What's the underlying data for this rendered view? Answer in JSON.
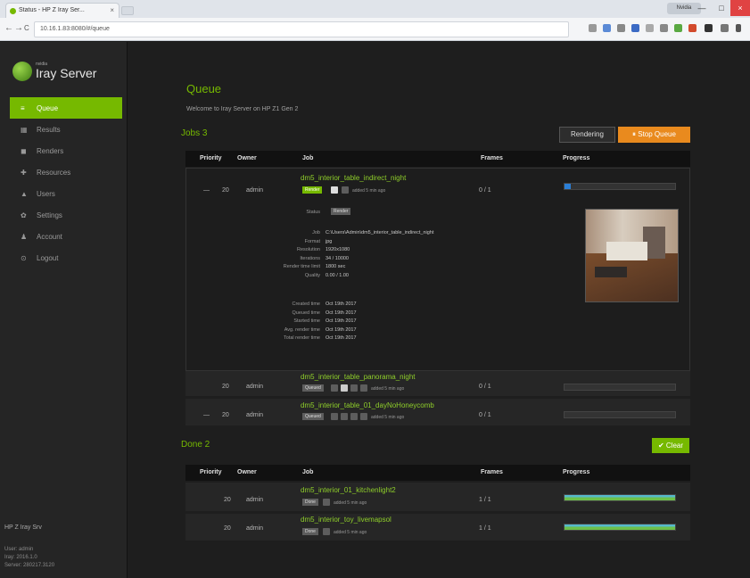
{
  "browser": {
    "tab_title": "Status - HP Z Iray Ser...",
    "tab_close": "×",
    "url": "10.16.1.83:8080/#/queue",
    "user": "Nvidia",
    "controls": {
      "minimize": "—",
      "maximize": "□",
      "close": "×"
    },
    "nav": {
      "back": "←",
      "forward": "→",
      "reload": "C"
    }
  },
  "sidebar": {
    "brand_small": "nvidia",
    "brand": "Iray Server",
    "items": [
      {
        "label": "Queue",
        "icon": "≡",
        "active": true
      },
      {
        "label": "Results",
        "icon": "▦"
      },
      {
        "label": "Renders",
        "icon": "◼"
      },
      {
        "label": "Resources",
        "icon": "✚"
      },
      {
        "label": "Users",
        "icon": "▲"
      },
      {
        "label": "Settings",
        "icon": "✿"
      },
      {
        "label": "Account",
        "icon": "♟"
      },
      {
        "label": "Logout",
        "icon": "⊙"
      }
    ],
    "footer": {
      "title": "HP Z Iray Srv",
      "line1": "User: admin",
      "line2": "Iray: 2016.1.0",
      "line3": "Server: 280217.3120"
    }
  },
  "main": {
    "title": "Queue",
    "welcome": "Welcome to Iray Server on HP Z1 Gen 2",
    "jobs_title": "Jobs 3",
    "rendering_label": "Rendering",
    "stop_label": "⏸ Stop Queue",
    "done_title": "Done 2",
    "clear_label": "✔ Clear",
    "columns": {
      "priority": "Priority",
      "owner": "Owner",
      "job": "Job",
      "frames": "Frames",
      "progress": "Progress"
    },
    "jobs": [
      {
        "dash": "—",
        "priority": "20",
        "owner": "admin",
        "name": "dm5_interior_table_indirect_night",
        "status": "Render",
        "extra": "added 5 min ago",
        "frames": "0 / 1",
        "progress": 0.06,
        "progress_color": "#2b7fd6"
      },
      {
        "dash": "",
        "priority": "20",
        "owner": "admin",
        "name": "dm5_interior_table_panorama_night",
        "status": "Queued",
        "extra": "added 5 min ago",
        "frames": "0 / 1",
        "progress": 0,
        "progress_color": "#2b7fd6"
      },
      {
        "dash": "—",
        "priority": "20",
        "owner": "admin",
        "name": "dm5_interior_table_01_dayNoHoneycomb",
        "status": "Queued",
        "extra": "added 5 min ago",
        "frames": "0 / 1",
        "progress": 0,
        "progress_color": "#2b7fd6"
      }
    ],
    "details": {
      "status_label": "Status",
      "status_value": "Render",
      "rows": [
        {
          "label": "Job",
          "value": "C:\\Users\\Admin\\dm5_interior_table_indirect_night"
        },
        {
          "label": "Format",
          "value": "jpg"
        },
        {
          "label": "Resolution",
          "value": "1920x1080"
        },
        {
          "label": "Iterations",
          "value": "34 / 10000"
        },
        {
          "label": "Render time limit",
          "value": "1800 sec"
        },
        {
          "label": "Quality",
          "value": "0.00 / 1.00"
        }
      ],
      "times": [
        {
          "label": "Created time",
          "value": "Oct 19th 2017"
        },
        {
          "label": "Queued time",
          "value": "Oct 19th 2017"
        },
        {
          "label": "Started time",
          "value": "Oct 19th 2017"
        },
        {
          "label": "Avg. render time",
          "value": "Oct 19th 2017"
        },
        {
          "label": "Total render time",
          "value": "Oct 19th 2017"
        }
      ]
    },
    "done": [
      {
        "priority": "20",
        "owner": "admin",
        "name": "dm5_interior_01_kitchenlight2",
        "status": "Done",
        "extra": "added 5 min ago",
        "frames": "1 / 1",
        "progress": 1.0
      },
      {
        "priority": "20",
        "owner": "admin",
        "name": "dm5_interior_toy_livemapsol",
        "status": "Done",
        "extra": "added 5 min ago",
        "frames": "1 / 1",
        "progress": 1.0
      }
    ]
  }
}
